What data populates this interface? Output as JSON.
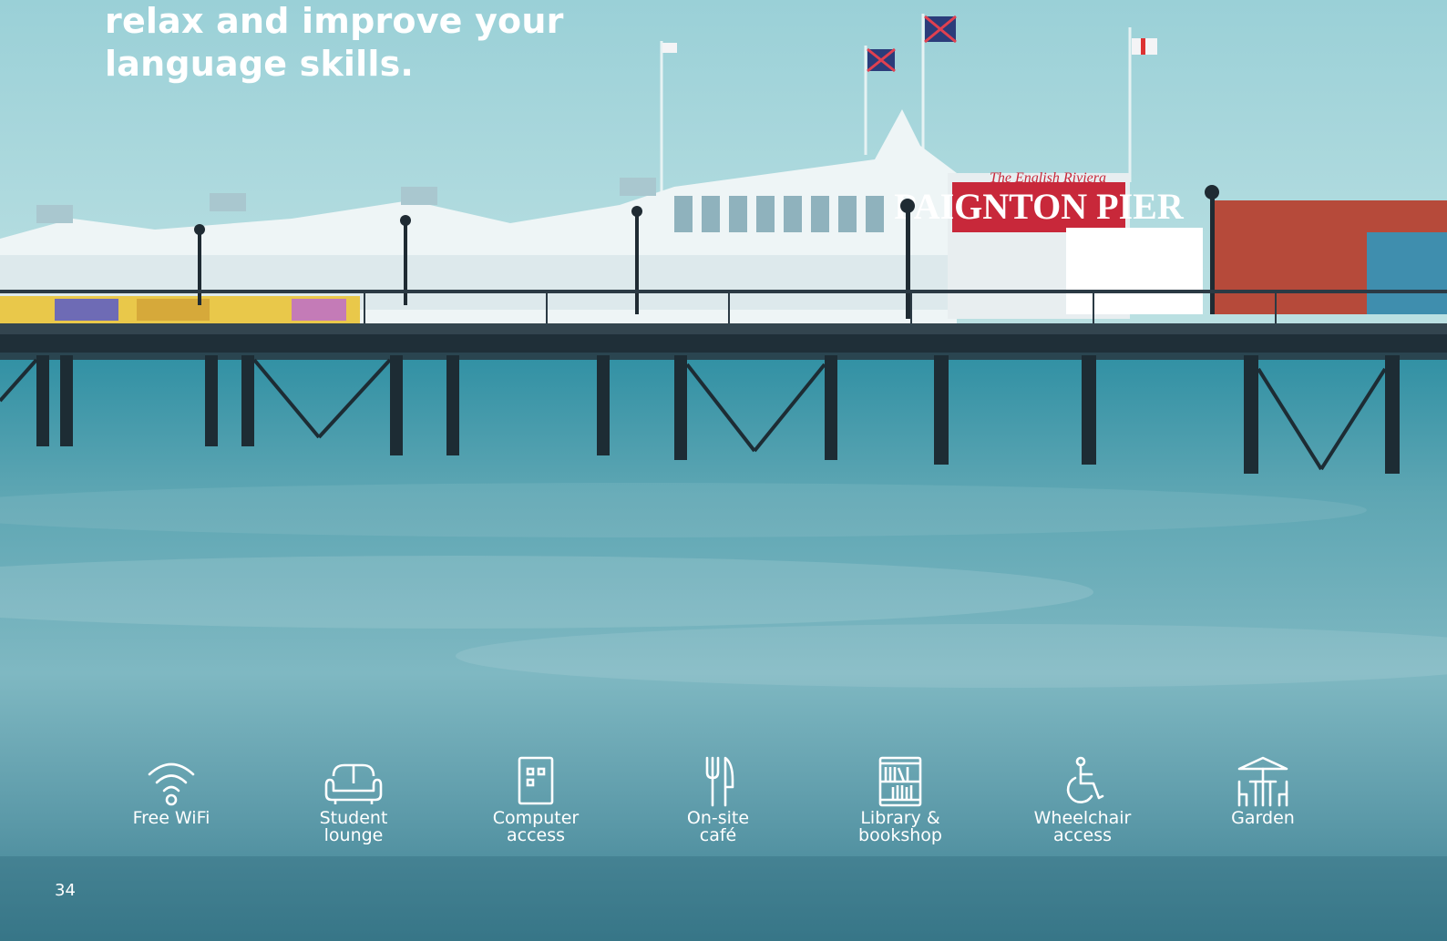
{
  "headline": {
    "line1": "relax and improve your",
    "line2": "language skills."
  },
  "sign": {
    "main": "PAIGNTON PIER",
    "script": "The English Riviera"
  },
  "amenities": [
    {
      "label": "Free WiFi",
      "icon": "wifi-icon"
    },
    {
      "label": "Student\nlounge",
      "icon": "sofa-icon"
    },
    {
      "label": "Computer\naccess",
      "icon": "computer-icon"
    },
    {
      "label": "On-site\ncafé",
      "icon": "fork-knife-icon"
    },
    {
      "label": "Library &\nbookshop",
      "icon": "bookshelf-icon"
    },
    {
      "label": "Wheelchair\naccess",
      "icon": "wheelchair-icon"
    },
    {
      "label": "Garden",
      "icon": "garden-table-icon"
    }
  ],
  "page_number": "34",
  "colors": {
    "sky": "#a9d6dc",
    "sea": "#3f8d9f",
    "sign_red": "#c8283a",
    "text": "#ffffff"
  }
}
